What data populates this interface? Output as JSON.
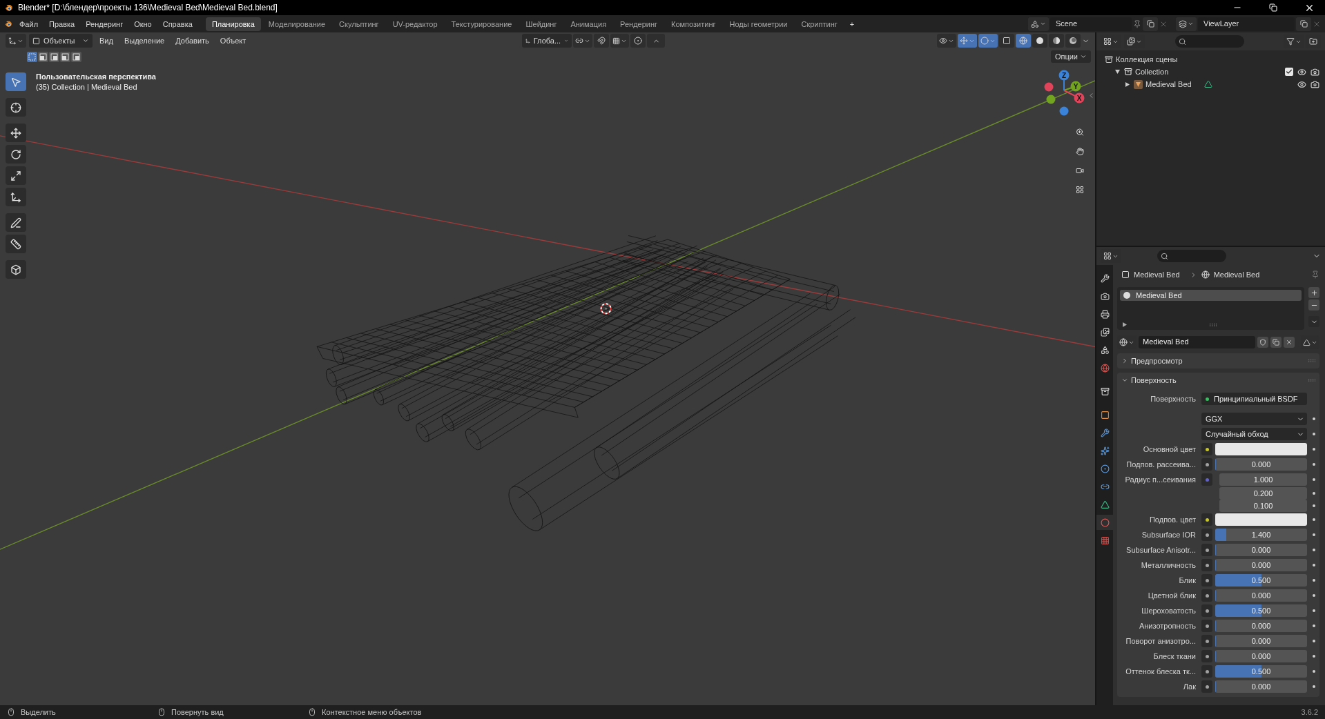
{
  "window": {
    "title": "Blender* [D:\\блендер\\проекты 136\\Medieval Bed\\Medieval Bed.blend]"
  },
  "menu": [
    "Файл",
    "Правка",
    "Рендеринг",
    "Окно",
    "Справка"
  ],
  "workspaces": [
    {
      "label": "Планировка",
      "selected": true
    },
    {
      "label": "Моделирование",
      "selected": false
    },
    {
      "label": "Скульптинг",
      "selected": false
    },
    {
      "label": "UV-редактор",
      "selected": false
    },
    {
      "label": "Текстурирование",
      "selected": false
    },
    {
      "label": "Шейдинг",
      "selected": false
    },
    {
      "label": "Анимация",
      "selected": false
    },
    {
      "label": "Рендеринг",
      "selected": false
    },
    {
      "label": "Композитинг",
      "selected": false
    },
    {
      "label": "Ноды геометрии",
      "selected": false
    },
    {
      "label": "Скриптинг",
      "selected": false
    }
  ],
  "add_workspace": "+",
  "scene": "Scene",
  "view_layer": "ViewLayer",
  "viewport": {
    "mode": "Объекты",
    "menus": [
      "Вид",
      "Выделение",
      "Добавить",
      "Объект"
    ],
    "orientation": "Глоба...",
    "options": "Опции",
    "info": [
      "Пользовательская перспектива",
      "(35) Collection | Medieval Bed"
    ],
    "select_modes": [
      {
        "selected": true
      },
      {
        "selected": false
      },
      {
        "selected": false
      },
      {
        "selected": false
      },
      {
        "selected": false
      }
    ],
    "shading": [
      {
        "kind": "wireframe",
        "selected": true
      },
      {
        "kind": "solid",
        "selected": false
      },
      {
        "kind": "material",
        "selected": false
      },
      {
        "kind": "rendered",
        "selected": false
      }
    ],
    "tools": [
      {
        "kind": "select",
        "selected": true
      },
      {
        "kind": "cursor",
        "selected": false
      },
      {
        "kind": "move",
        "selected": false
      },
      {
        "kind": "rotate",
        "selected": false
      },
      {
        "kind": "scale",
        "selected": false
      },
      {
        "kind": "transform",
        "selected": false
      },
      {
        "kind": "annotate",
        "selected": false
      },
      {
        "kind": "measure",
        "selected": false
      },
      {
        "kind": "add_cube",
        "selected": false
      }
    ],
    "gizmo": [
      {
        "label": "Z",
        "color": "#3b83d9"
      },
      {
        "label": "Y",
        "color": "#73a41f"
      },
      {
        "label": "X",
        "color": "#e0445a"
      }
    ]
  },
  "outliner": {
    "items": [
      {
        "label": "Коллекция сцены",
        "kind": "scene_collection",
        "children": [
          {
            "label": "Collection",
            "kind": "collection",
            "expanded": true,
            "checked": true,
            "children": [
              {
                "label": "Medieval Bed",
                "kind": "object",
                "expanded": false
              }
            ]
          }
        ]
      }
    ]
  },
  "properties": {
    "tabs": [
      {
        "kind": "tool",
        "selected": false
      },
      {
        "kind": "render",
        "selected": false
      },
      {
        "kind": "output",
        "selected": false
      },
      {
        "kind": "view_layer",
        "selected": false
      },
      {
        "kind": "scene",
        "selected": false
      },
      {
        "kind": "world",
        "selected": false
      },
      {
        "kind": "collection",
        "selected": false
      },
      {
        "kind": "object",
        "selected": false
      },
      {
        "kind": "modifier",
        "selected": false
      },
      {
        "kind": "particles",
        "selected": false
      },
      {
        "kind": "physics",
        "selected": false
      },
      {
        "kind": "constraints",
        "selected": false
      },
      {
        "kind": "data",
        "selected": false
      },
      {
        "kind": "material",
        "selected": true
      },
      {
        "kind": "texture",
        "selected": false
      }
    ],
    "breadcrumb": [
      "Medieval Bed",
      "Medieval Bed"
    ],
    "slots": [
      {
        "name": "Medieval Bed",
        "selected": true
      }
    ],
    "material": "Medieval Bed",
    "panels": [
      {
        "title": "Предпросмотр",
        "expanded": false
      },
      {
        "title": "Поверхность",
        "expanded": true
      }
    ],
    "surface": {
      "label": "Поверхность",
      "value": "Принципиальный BSDF"
    },
    "fields": [
      {
        "kind": "dropdown",
        "value": "GGX"
      },
      {
        "kind": "dropdown",
        "value": "Случайный обход"
      },
      {
        "kind": "color",
        "label": "Основной цвет",
        "color": "#c7c729"
      },
      {
        "kind": "number",
        "label": "Подпов. рассеива...",
        "color": "#a1a1a1",
        "value": "0.000",
        "level": 0
      },
      {
        "kind": "vector",
        "label": "Радиус п...сеивания",
        "color": "#6363c7",
        "values": [
          "1.000",
          "0.200",
          "0.100"
        ]
      },
      {
        "kind": "color",
        "label": "Подпов. цвет",
        "color": "#c7c729"
      },
      {
        "kind": "number",
        "label": "Subsurface IOR",
        "color": "#a1a1a1",
        "value": "1.400",
        "level": 0.12
      },
      {
        "kind": "number",
        "label": "Subsurface Anisotr...",
        "color": "#a1a1a1",
        "value": "0.000",
        "level": 0
      },
      {
        "kind": "number",
        "label": "Металличность",
        "color": "#a1a1a1",
        "value": "0.000",
        "level": 0
      },
      {
        "kind": "number",
        "label": "Блик",
        "color": "#a1a1a1",
        "value": "0.500",
        "level": 0.5
      },
      {
        "kind": "number",
        "label": "Цветной блик",
        "color": "#a1a1a1",
        "value": "0.000",
        "level": 0
      },
      {
        "kind": "number",
        "label": "Шероховатость",
        "color": "#a1a1a1",
        "value": "0.500",
        "level": 0.5
      },
      {
        "kind": "number",
        "label": "Анизотропность",
        "color": "#a1a1a1",
        "value": "0.000",
        "level": 0
      },
      {
        "kind": "number",
        "label": "Поворот анизотро...",
        "color": "#a1a1a1",
        "value": "0.000",
        "level": 0
      },
      {
        "kind": "number",
        "label": "Блеск ткани",
        "color": "#a1a1a1",
        "value": "0.000",
        "level": 0
      },
      {
        "kind": "number",
        "label": "Оттенок блеска тк...",
        "color": "#a1a1a1",
        "value": "0.500",
        "level": 0.5
      },
      {
        "kind": "number",
        "label": "Лак",
        "color": "#a1a1a1",
        "value": "0.000",
        "level": 0
      }
    ]
  },
  "status_bar": {
    "hints": [
      "Выделить",
      "Повернуть вид",
      "Контекстное меню объектов"
    ],
    "version": "3.6.2"
  }
}
